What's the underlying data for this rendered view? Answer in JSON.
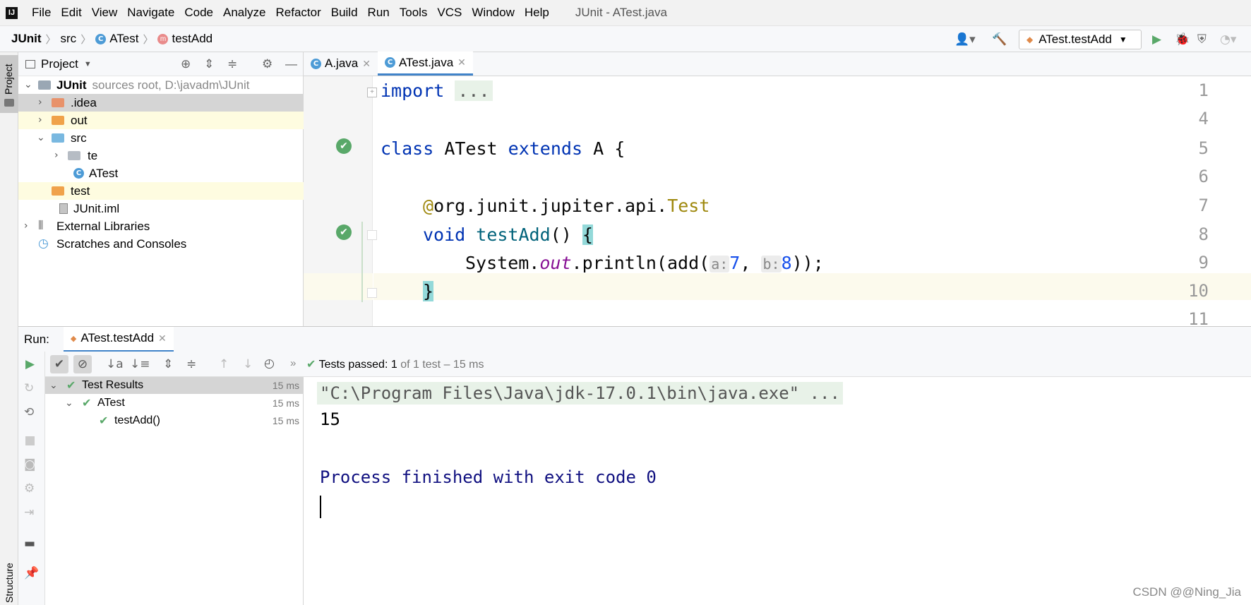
{
  "menubar": {
    "items": [
      "File",
      "Edit",
      "View",
      "Navigate",
      "Code",
      "Analyze",
      "Refactor",
      "Build",
      "Run",
      "Tools",
      "VCS",
      "Window",
      "Help"
    ],
    "window_title": "JUnit - ATest.java"
  },
  "navbar": {
    "crumbs": [
      "JUnit",
      "src",
      "ATest",
      "testAdd"
    ],
    "run_config": "ATest.testAdd"
  },
  "left_strip": {
    "project_label": "Project",
    "structure_label": "Structure"
  },
  "project": {
    "header": "Project",
    "root_name": "JUnit",
    "root_detail": "sources root,  D:\\javadm\\JUnit",
    "items": [
      ".idea",
      "out",
      "src",
      "te",
      "ATest",
      "test",
      "JUnit.iml",
      "External Libraries",
      "Scratches and Consoles"
    ]
  },
  "editor": {
    "tabs": [
      "A.java",
      "ATest.java"
    ],
    "line_numbers": [
      "1",
      "4",
      "5",
      "6",
      "7",
      "8",
      "9",
      "10",
      "11"
    ],
    "code": {
      "import_kw": "import",
      "import_fold": "...",
      "class_kw": "class",
      "class_name": "ATest",
      "extends_kw": "extends",
      "super_name": "A",
      "brace_open": "{",
      "annotation_at": "@",
      "annotation_pkg": "org.junit.jupiter.api.",
      "annotation_name": "Test",
      "void_kw": "void",
      "method_name": "testAdd",
      "method_parens": "()",
      "system": "System.",
      "out": "out",
      "println": ".println(add(",
      "hint_a": "a:",
      "arg_a": "7",
      "comma": ",",
      "hint_b": "b:",
      "arg_b": "8",
      "close_call": "));",
      "brace_close": "}"
    }
  },
  "run": {
    "label": "Run:",
    "tab": "ATest.testAdd",
    "status_prefix": "Tests passed:",
    "status_count": "1",
    "status_suffix": "of 1 test – 15 ms",
    "tree": [
      {
        "name": "Test Results",
        "time": "15 ms"
      },
      {
        "name": "ATest",
        "time": "15 ms"
      },
      {
        "name": "testAdd()",
        "time": "15 ms"
      }
    ],
    "console": [
      "\"C:\\Program Files\\Java\\jdk-17.0.1\\bin\\java.exe\" ...",
      "15",
      "Process finished with exit code 0"
    ]
  },
  "watermark": "CSDN @@Ning_Jia",
  "colors": {
    "keyword": "#0033b3",
    "annotation": "#9e880d",
    "success": "#59a869",
    "accent": "#4083c9"
  }
}
